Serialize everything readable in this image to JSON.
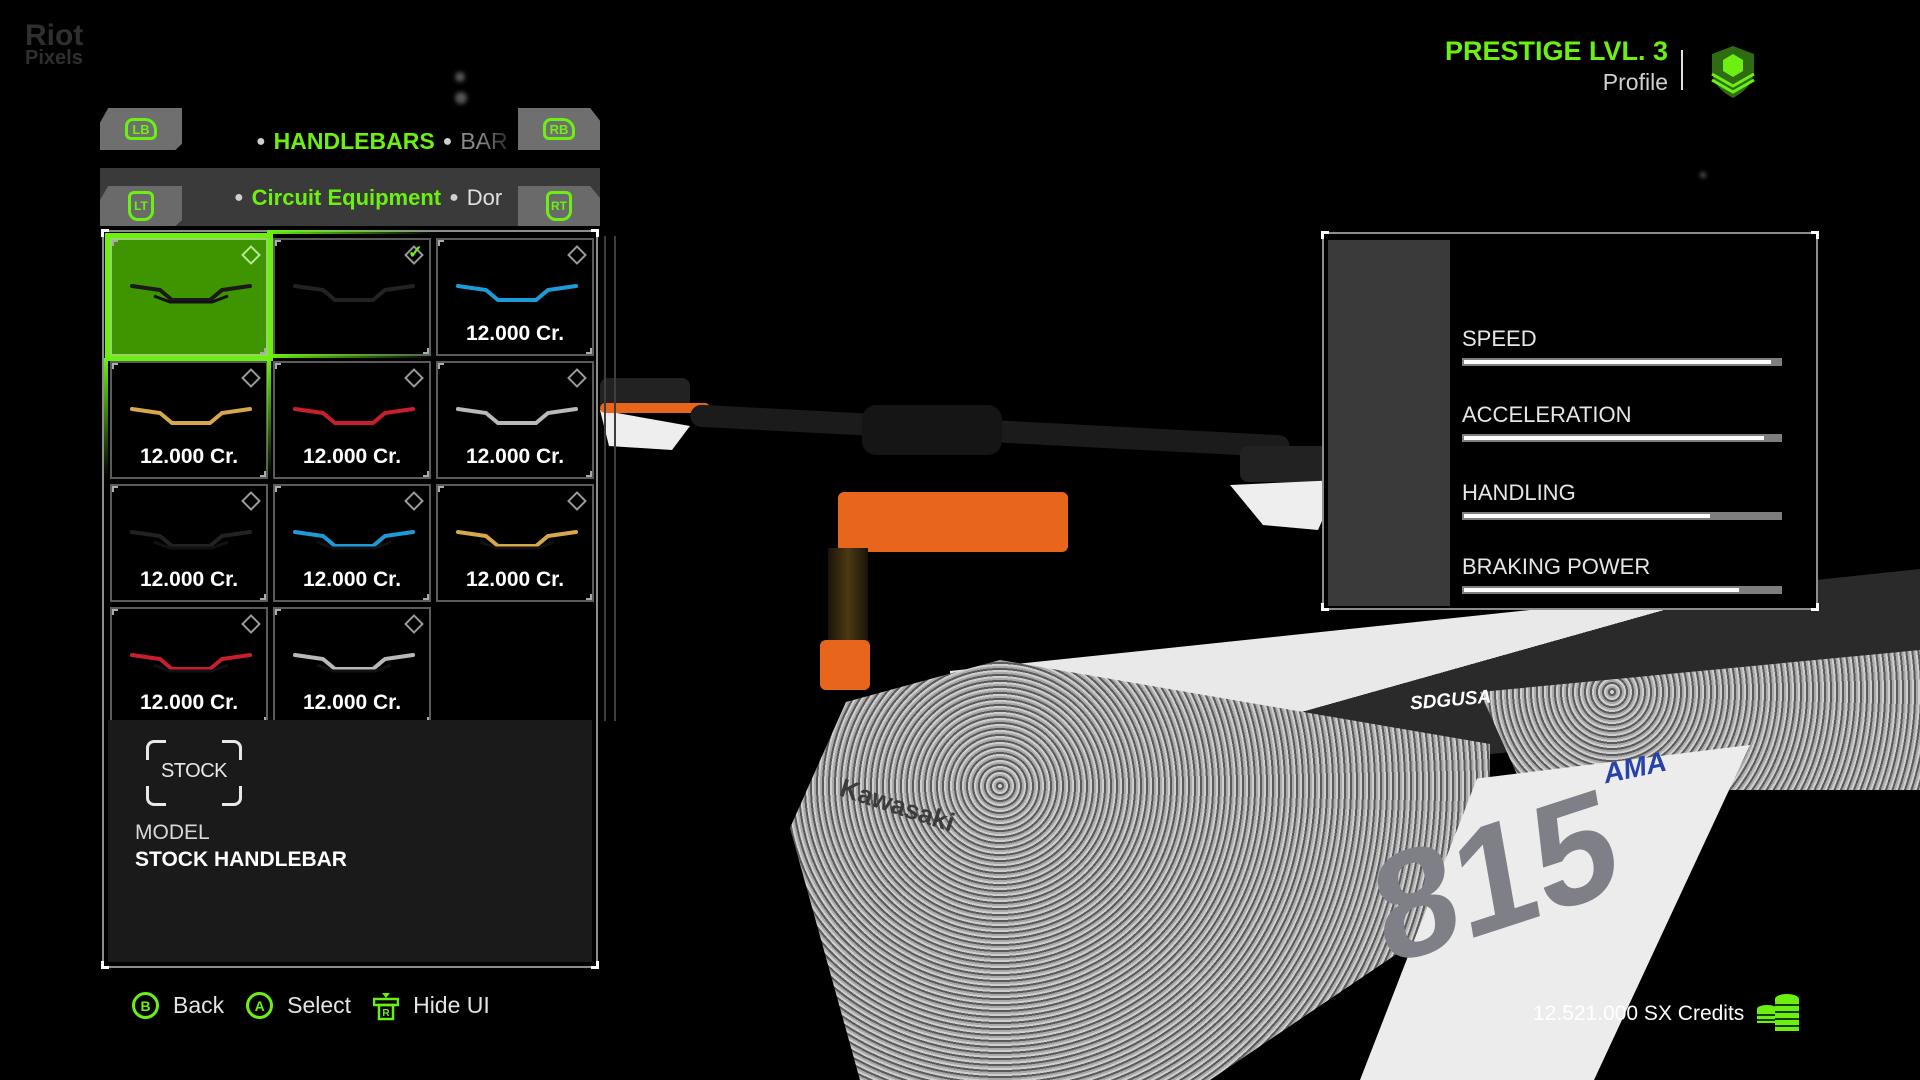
{
  "watermark": {
    "line1": "Riot",
    "line2": "Pixels"
  },
  "profile": {
    "prestige": "PRESTIGE LVL. 3",
    "label": "Profile",
    "accent": "#6cf012"
  },
  "category_tabs": {
    "left_button": "LB",
    "right_button": "RB",
    "active": "HANDLEBARS",
    "next": "BAR"
  },
  "sub_tabs": {
    "left_button": "LT",
    "right_button": "RT",
    "active": "Circuit Equipment",
    "next": "Dor"
  },
  "items": [
    {
      "price": "",
      "color": "#1a1a1a",
      "state": "selected",
      "style": "crossbar",
      "icon": "diamond-icon"
    },
    {
      "price": "",
      "color": "#222222",
      "state": "equipped",
      "style": "plain",
      "icon": "check-icon"
    },
    {
      "price": "12.000 Cr.",
      "color": "#1e9ad6",
      "state": "locked",
      "style": "plain",
      "icon": "diamond-icon"
    },
    {
      "price": "12.000 Cr.",
      "color": "#d7a84a",
      "state": "locked",
      "style": "plain",
      "icon": "diamond-icon"
    },
    {
      "price": "12.000 Cr.",
      "color": "#c81e2e",
      "state": "locked",
      "style": "plain",
      "icon": "diamond-icon"
    },
    {
      "price": "12.000 Cr.",
      "color": "#b9b9b9",
      "state": "locked",
      "style": "plain",
      "icon": "diamond-icon"
    },
    {
      "price": "12.000 Cr.",
      "color": "#222222",
      "state": "locked",
      "style": "crossbar",
      "icon": "diamond-icon"
    },
    {
      "price": "12.000 Cr.",
      "color": "#1e9ad6",
      "state": "locked",
      "style": "crossbar",
      "icon": "diamond-icon"
    },
    {
      "price": "12.000 Cr.",
      "color": "#d7a84a",
      "state": "locked",
      "style": "crossbar",
      "icon": "diamond-icon"
    },
    {
      "price": "12.000 Cr.",
      "color": "#c81e2e",
      "state": "locked",
      "style": "crossbar",
      "icon": "diamond-icon"
    },
    {
      "price": "12.000 Cr.",
      "color": "#b9b9b9",
      "state": "locked",
      "style": "crossbar",
      "icon": "diamond-icon"
    }
  ],
  "info": {
    "badge": "STOCK",
    "model_label": "MODEL",
    "model_value": "STOCK HANDLEBAR"
  },
  "hints": [
    {
      "button": "B",
      "label": "Back"
    },
    {
      "button": "A",
      "label": "Select"
    },
    {
      "button": "R",
      "label": "Hide UI"
    }
  ],
  "stats": [
    {
      "label": "SPEED",
      "value": 0.97
    },
    {
      "label": "ACCELERATION",
      "value": 0.95
    },
    {
      "label": "HANDLING",
      "value": 0.78
    },
    {
      "label": "BRAKING POWER",
      "value": 0.87
    }
  ],
  "credits": {
    "text": "12.521.000 SX Credits"
  },
  "bike": {
    "number": "815",
    "brand": "Kawasaki",
    "seat_logo": "SDGUSA",
    "sponsor": "AMA"
  }
}
